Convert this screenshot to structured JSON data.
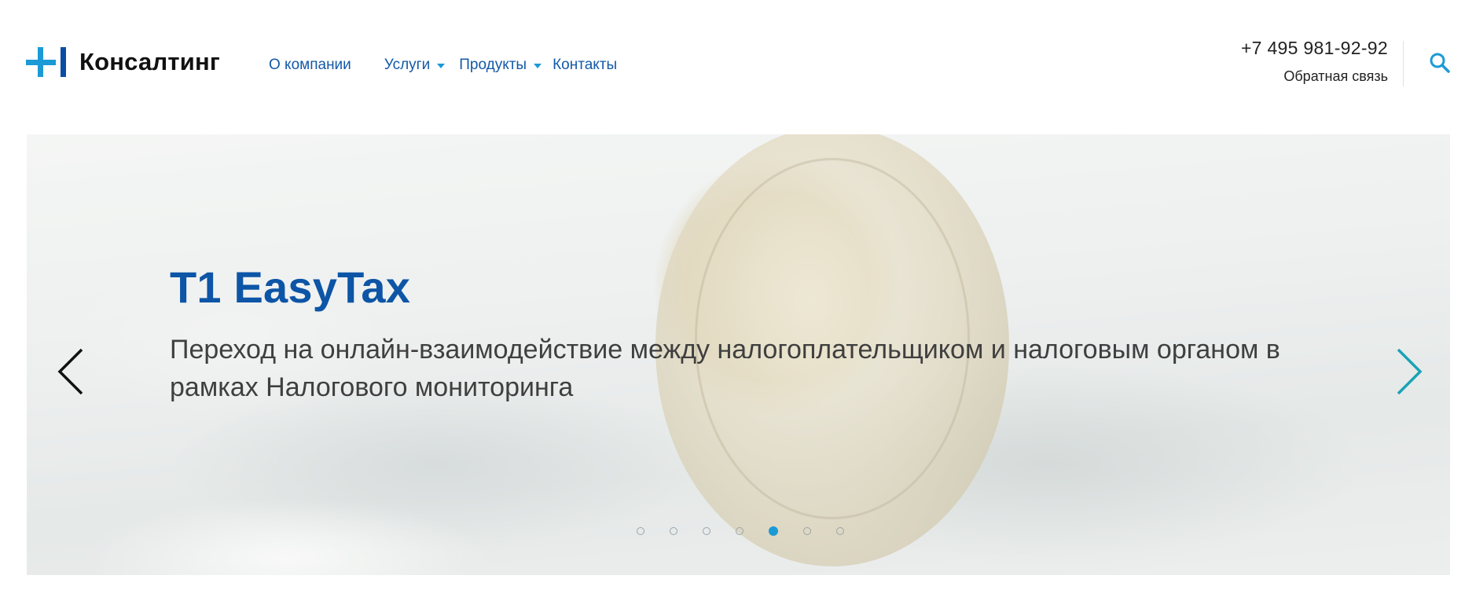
{
  "header": {
    "logo_text": "Консалтинг",
    "nav": [
      {
        "label": "О компании",
        "has_dropdown": false
      },
      {
        "label": "Услуги",
        "has_dropdown": true
      },
      {
        "label": "Продукты",
        "has_dropdown": true
      },
      {
        "label": "Контакты",
        "has_dropdown": false
      }
    ],
    "phone": "+7 495 981-92-92",
    "feedback_label": "Обратная связь",
    "search_icon": "search-icon"
  },
  "slider": {
    "title": "T1 EasyTax",
    "text": "Переход на онлайн-взаимодействие между налогоплательщиком и налоговым органом в рамках Налогового мониторинга",
    "prev_icon": "chevron-left-icon",
    "next_icon": "chevron-right-icon",
    "dots_total": 7,
    "active_dot": 5
  },
  "colors": {
    "brand_blue": "#0d55a6",
    "accent_blue": "#1b9ad6",
    "nav_text": "#1459a8"
  }
}
